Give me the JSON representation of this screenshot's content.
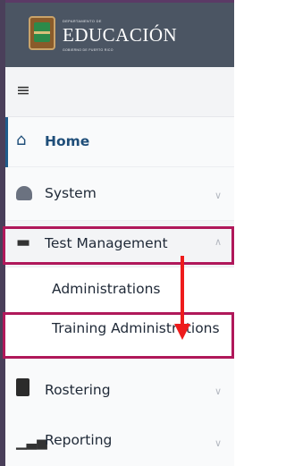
{
  "header": {
    "logo_top_text": "DEPARTAMENTO DE",
    "logo_main_text": "EDUCACIÓN",
    "logo_bottom_text": "GOBIERNO DE PUERTO RICO"
  },
  "menu_toggle": {
    "icon": "hamburger-icon",
    "glyph": "≡"
  },
  "nav": {
    "home": {
      "label": "Home",
      "icon": "home-icon",
      "active": true
    },
    "system": {
      "label": "System",
      "icon": "system-icon",
      "expanded": false
    },
    "test_management": {
      "label": "Test Management",
      "icon": "folder-icon",
      "expanded": true,
      "children": [
        {
          "label": "Administrations"
        },
        {
          "label": "Training Administrations"
        }
      ]
    },
    "rostering": {
      "label": "Rostering",
      "icon": "badge-icon",
      "expanded": false
    },
    "reporting": {
      "label": "Reporting",
      "icon": "bar-chart-icon",
      "expanded": false
    }
  },
  "colors": {
    "header_bg": "#4b5563",
    "active_accent": "#1f4e79",
    "highlight_border": "#b0185a",
    "annotation_arrow": "#ee1c1c"
  }
}
